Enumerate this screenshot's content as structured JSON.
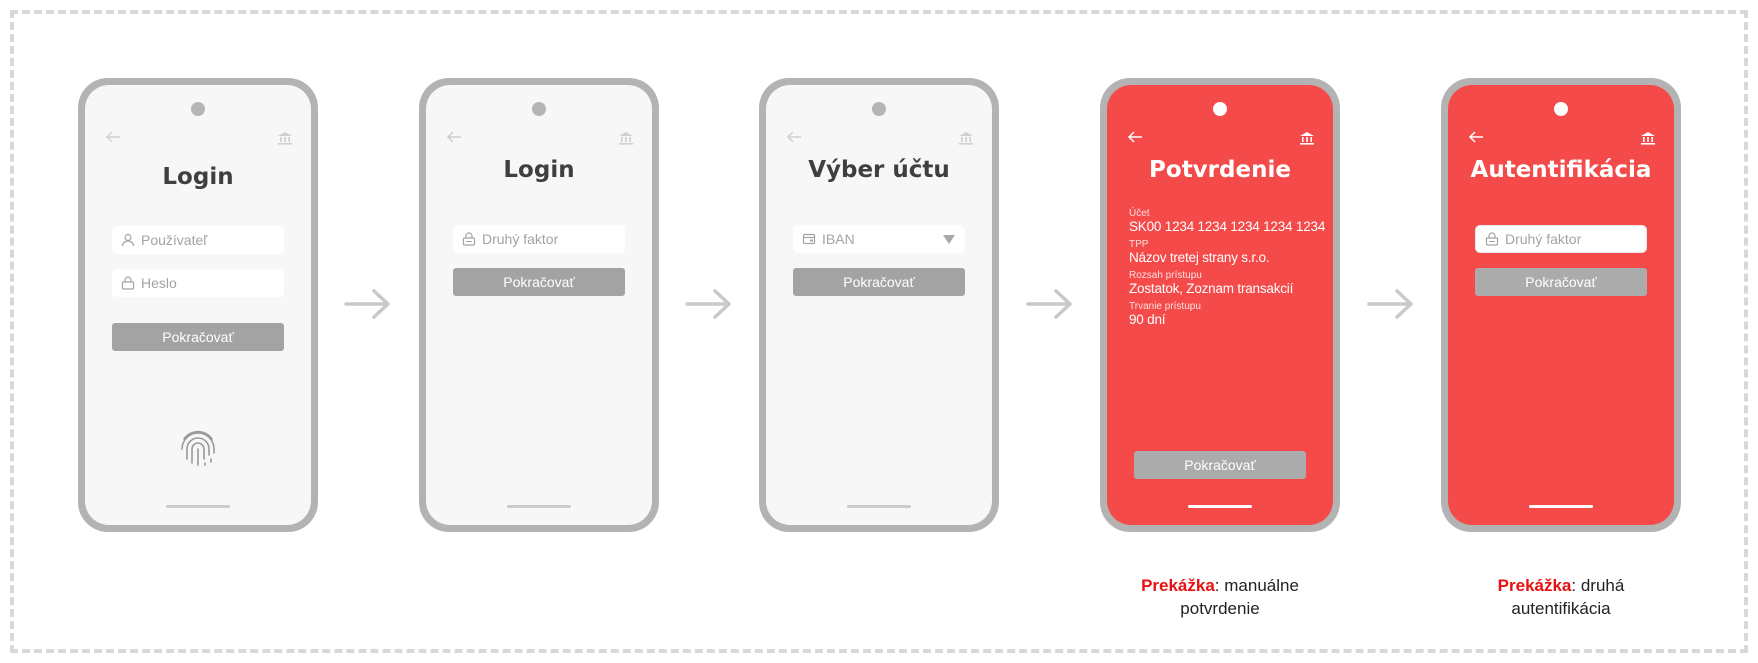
{
  "screens": [
    {
      "title": "Login",
      "username_placeholder": "Používateľ",
      "password_placeholder": "Heslo",
      "button_label": "Pokračovať"
    },
    {
      "title": "Login",
      "second_factor_placeholder": "Druhý faktor",
      "button_label": "Pokračovať"
    },
    {
      "title": "Výber účtu",
      "select_value": "IBAN",
      "button_label": "Pokračovať"
    },
    {
      "title": "Potvrdenie",
      "details": [
        {
          "label": "Účet",
          "value": "SK00 1234 1234 1234 1234 1234"
        },
        {
          "label": "TPP",
          "value": "Názov tretej strany s.r.o."
        },
        {
          "label": "Rozsah prístupu",
          "value": "Zostatok, Zoznam transakcií"
        },
        {
          "label": "Trvanie prístupu",
          "value": "90 dní"
        }
      ],
      "button_label": "Pokračovať"
    },
    {
      "title": "Autentifikácia",
      "second_factor_placeholder": "Druhý faktor",
      "button_label": "Pokračovať"
    }
  ],
  "captions": [
    {
      "highlight": "Prekážka",
      "text_line1": ": manuálne",
      "text_line2": "potvrdenie"
    },
    {
      "highlight": "Prekážka",
      "text_line1": ": druhá",
      "text_line2": "autentifikácia"
    }
  ],
  "colors": {
    "brand_red": "#f44a4a",
    "highlight_red": "#e81111",
    "phone_frame": "#b3b3b3",
    "button_gray": "#a3a3a3"
  },
  "icons": {
    "back": "arrow-left-icon",
    "bank": "bank-icon",
    "user": "user-icon",
    "lock": "lock-icon",
    "card": "card-icon",
    "fingerprint": "fingerprint-icon",
    "flow_arrow": "arrow-right-icon"
  }
}
